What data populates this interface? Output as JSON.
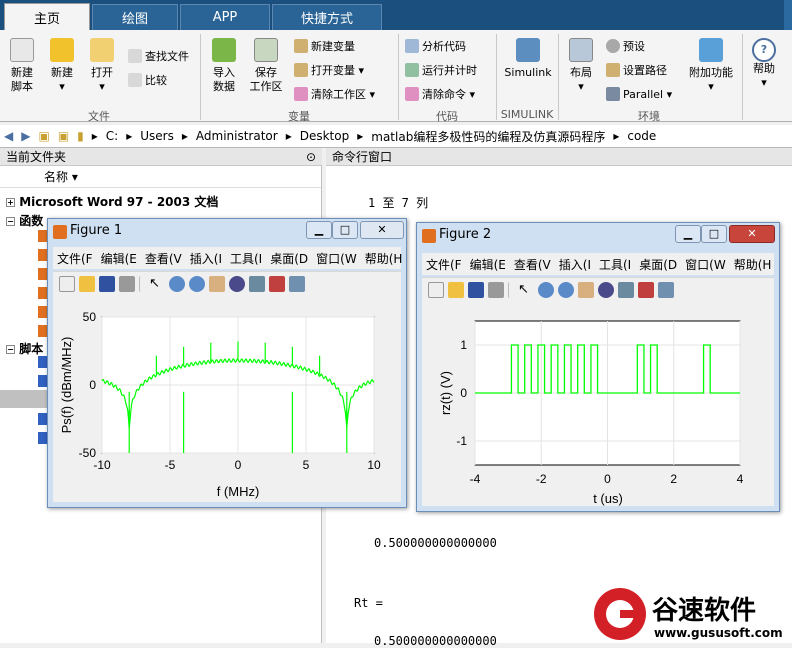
{
  "tabs": [
    "主页",
    "绘图",
    "APP",
    "快捷方式"
  ],
  "ribbon": {
    "new_script": [
      "新建",
      "脚本"
    ],
    "new": "新建",
    "open": "打开",
    "find_files": "查找文件",
    "compare": "比较",
    "import_data": [
      "导入",
      "数据"
    ],
    "save_workspace": [
      "保存",
      "工作区"
    ],
    "new_variable": "新建变量",
    "open_variable": "打开变量",
    "clear_workspace": "清除工作区",
    "analyze_code": "分析代码",
    "run_and_time": "运行并计时",
    "clear_commands": "清除命令",
    "simulink": "Simulink",
    "layout": "布局",
    "preferences": "预设",
    "set_path": "设置路径",
    "parallel": "Parallel",
    "addons": "附加功能",
    "help": "帮助",
    "groups": [
      "文件",
      "变量",
      "代码",
      "SIMULINK",
      "环境"
    ]
  },
  "address": {
    "path": [
      "C:",
      "Users",
      "Administrator",
      "Desktop",
      "matlab编程多极性码的编程及仿真源码程序",
      "code"
    ]
  },
  "left_panel": {
    "title": "当前文件夹",
    "col_header": "名称",
    "rows": [
      "Microsoft Word 97 - 2003 文档",
      "函数",
      "脚本"
    ]
  },
  "right_panel": {
    "title": "命令行窗口",
    "lines": [
      "1 至 7 列",
      "0.500000000000000",
      "Rt =",
      "0.500000000000000"
    ]
  },
  "fig1": {
    "title": "Figure 1",
    "menus": [
      "文件(F",
      "编辑(E",
      "查看(V",
      "插入(I",
      "工具(I",
      "桌面(D",
      "窗口(W",
      "帮助(H"
    ],
    "xlabel": "f  (MHz)",
    "ylabel": "Ps(f)  (dBm/MHz)"
  },
  "fig2": {
    "title": "Figure 2",
    "menus": [
      "文件(F",
      "编辑(E",
      "查看(V",
      "插入(I",
      "工具(I",
      "桌面(D",
      "窗口(W",
      "帮助(H"
    ],
    "xlabel": "t (us)",
    "ylabel": "rz(t) (V)"
  },
  "chart_data": [
    {
      "type": "line",
      "x_range": [
        -10,
        10
      ],
      "ylim": [
        -50,
        50
      ],
      "xticks": [
        -10,
        -5,
        0,
        5,
        10
      ],
      "yticks": [
        -50,
        0,
        50
      ],
      "grid": true,
      "color": "#00ff00",
      "nulls_at": [
        -8,
        -4,
        4,
        8
      ],
      "spectral_lines": [
        -8,
        -6,
        -4,
        -2,
        0,
        2,
        4,
        6,
        8
      ]
    },
    {
      "type": "line",
      "x_range": [
        -4,
        4
      ],
      "ylim": [
        -1.5,
        1.5
      ],
      "xticks": [
        -4,
        -2,
        0,
        2,
        4
      ],
      "yticks": [
        -1,
        0,
        1
      ],
      "grid": true,
      "color": "#00ff00",
      "pulses": [
        [
          -2.9,
          -2.7
        ],
        [
          -2.5,
          -2.3
        ],
        [
          -2.1,
          -1.9
        ],
        [
          -1.7,
          -1.5
        ],
        [
          -1.3,
          -1.1
        ],
        [
          -0.9,
          -0.7
        ],
        [
          -0.5,
          -0.3
        ],
        [
          0.9,
          1.1
        ],
        [
          1.3,
          1.5
        ],
        [
          2.9,
          3.1
        ]
      ]
    }
  ],
  "watermark": {
    "brand": "谷速软件",
    "url": "www.gususoft.com"
  },
  "colors": {
    "tabbar": "#1a4f7e",
    "plotline": "#00ff00"
  }
}
